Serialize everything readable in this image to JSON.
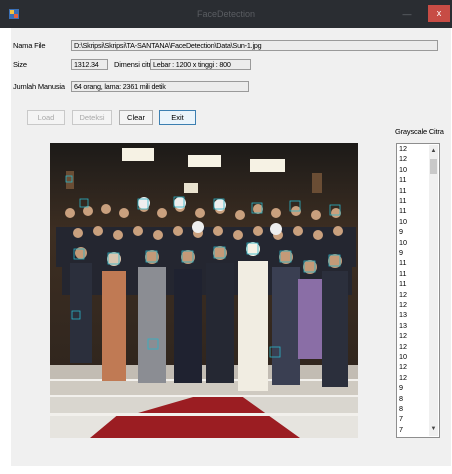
{
  "window": {
    "title": "FaceDetection",
    "min_glyph": "—",
    "close_glyph": "x"
  },
  "form": {
    "nama_file": {
      "label": "Nama File",
      "value": "D:\\Skripsi\\Skripsi\\TA-SANTANA\\FaceDetection\\Data\\Sun-1.jpg"
    },
    "size": {
      "label": "Size",
      "value": "1312.34"
    },
    "dimensi": {
      "label": "Dimensi citra",
      "value": "Lebar : 1200 x tinggi : 800"
    },
    "jumlah": {
      "label": "Jumlah Manusia",
      "value": "64 orang, lama: 2361 mili detik"
    }
  },
  "buttons": {
    "load": "Load",
    "deteksi": "Deteksi",
    "clear": "Clear",
    "exit": "Exit"
  },
  "grayscale": {
    "label": "Grayscale Citra",
    "items": [
      "12",
      "12",
      "10",
      "11",
      "11",
      "11",
      "11",
      "10",
      "9",
      "10",
      "9",
      "11",
      "11",
      "11",
      "12",
      "12",
      "13",
      "13",
      "12",
      "12",
      "10",
      "12",
      "12",
      "9",
      "8",
      "8",
      "7",
      "7"
    ]
  },
  "colors": {
    "titlebar": "#2a2d32",
    "close": "#c74c45",
    "client": "#f0f0f0",
    "detect_box": "#2bb5c8"
  }
}
